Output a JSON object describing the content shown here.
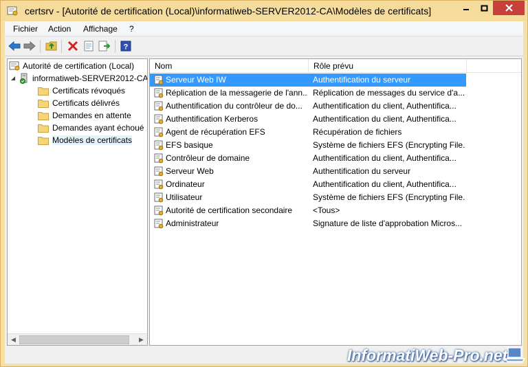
{
  "window": {
    "title": "certsrv - [Autorité de certification (Local)\\informatiweb-SERVER2012-CA\\Modèles de certificats]"
  },
  "menu": [
    "Fichier",
    "Action",
    "Affichage",
    "?"
  ],
  "toolbar": {
    "icons": [
      "back-arrow-icon",
      "forward-arrow-icon",
      "up-folder-icon",
      "delete-icon",
      "properties-icon",
      "export-icon",
      "help-icon"
    ]
  },
  "tree": {
    "root": "Autorité de certification (Local)",
    "ca": "informatiweb-SERVER2012-CA",
    "folders": [
      "Certificats révoqués",
      "Certificats délivrés",
      "Demandes en attente",
      "Demandes ayant échoué",
      "Modèles de certificats"
    ],
    "selected_folder": "Modèles de certificats"
  },
  "list": {
    "columns": [
      "Nom",
      "Rôle prévu"
    ],
    "rows": [
      {
        "name": "Serveur Web IW",
        "role": "Authentification du serveur",
        "selected": true
      },
      {
        "name": "Réplication de la messagerie de l'ann...",
        "role": "Réplication de messages du service d'a..."
      },
      {
        "name": "Authentification du contrôleur de do...",
        "role": "Authentification du client, Authentifica..."
      },
      {
        "name": "Authentification Kerberos",
        "role": "Authentification du client, Authentifica..."
      },
      {
        "name": "Agent de récupération EFS",
        "role": "Récupération de fichiers"
      },
      {
        "name": "EFS basique",
        "role": "Système de fichiers EFS (Encrypting File..."
      },
      {
        "name": "Contrôleur de domaine",
        "role": "Authentification du client, Authentifica..."
      },
      {
        "name": "Serveur Web",
        "role": "Authentification du serveur"
      },
      {
        "name": "Ordinateur",
        "role": "Authentification du client, Authentifica..."
      },
      {
        "name": "Utilisateur",
        "role": "Système de fichiers EFS (Encrypting File..."
      },
      {
        "name": "Autorité de certification secondaire",
        "role": "<Tous>"
      },
      {
        "name": "Administrateur",
        "role": "Signature de liste d'approbation Micros..."
      }
    ]
  },
  "watermark": "InformatiWeb-Pro.net",
  "colors": {
    "title_bar": "#f6dc9c",
    "close_button": "#c7413a",
    "selection": "#3399ff"
  }
}
